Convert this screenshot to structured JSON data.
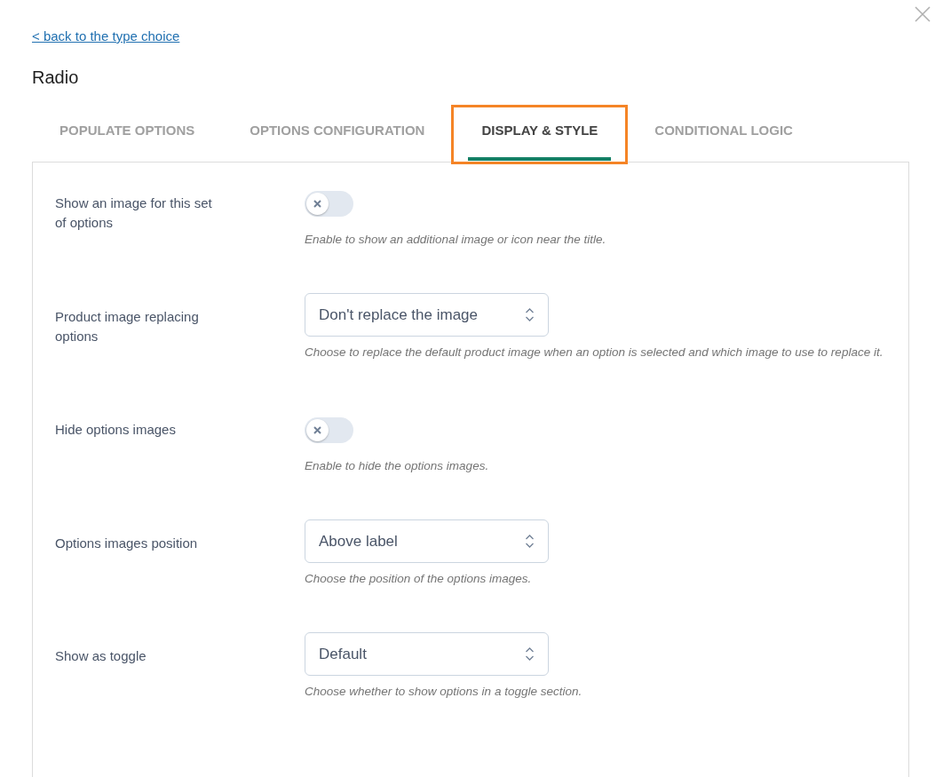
{
  "back_link": "< back to the type choice",
  "title": "Radio",
  "tabs": [
    {
      "label": "POPULATE OPTIONS",
      "selected": false,
      "highlighted": false
    },
    {
      "label": "OPTIONS CONFIGURATION",
      "selected": false,
      "highlighted": false
    },
    {
      "label": "DISPLAY & STYLE",
      "selected": true,
      "highlighted": true
    },
    {
      "label": "CONDITIONAL LOGIC",
      "selected": false,
      "highlighted": false
    }
  ],
  "settings": [
    {
      "kind": "toggle",
      "label": "Show an image for this set of options",
      "on": false,
      "description": "Enable to show an additional image or icon near the title."
    },
    {
      "kind": "select",
      "label": "Product image replacing options",
      "value": "Don't replace the image",
      "description": "Choose to replace the default product image when an option is selected and which image to use to replace it."
    },
    {
      "kind": "toggle",
      "label": "Hide options images",
      "on": false,
      "description": "Enable to hide the options images."
    },
    {
      "kind": "select",
      "label": "Options images position",
      "value": "Above label",
      "description": "Choose the position of the options images."
    },
    {
      "kind": "select",
      "label": "Show as toggle",
      "value": "Default",
      "description": "Choose whether to show options in a toggle section."
    }
  ]
}
